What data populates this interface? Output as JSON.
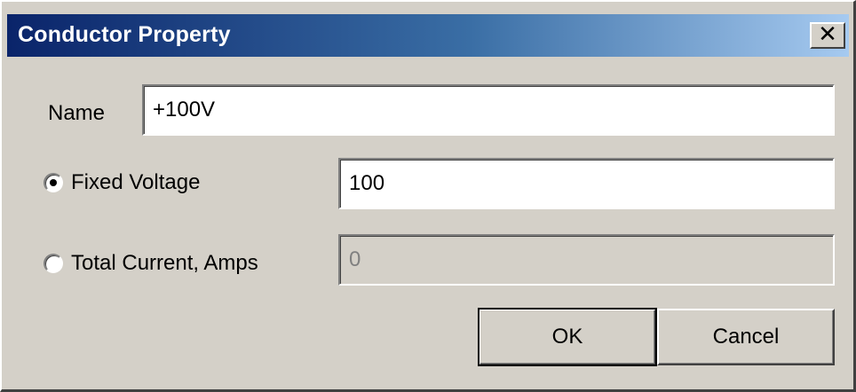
{
  "window": {
    "title": "Conductor Property",
    "close_glyph": "✕"
  },
  "form": {
    "name_label": "Name",
    "name_value": "+100V",
    "fixed_voltage_label": "Fixed Voltage",
    "fixed_voltage_value": "100",
    "fixed_voltage_selected": true,
    "total_current_label": "Total Current, Amps",
    "total_current_value": "0",
    "total_current_selected": false
  },
  "buttons": {
    "ok_label": "OK",
    "cancel_label": "Cancel"
  },
  "colors": {
    "title_gradient_start": "#0a246a",
    "title_gradient_end": "#a6caf0",
    "face": "#d4d0c8"
  }
}
